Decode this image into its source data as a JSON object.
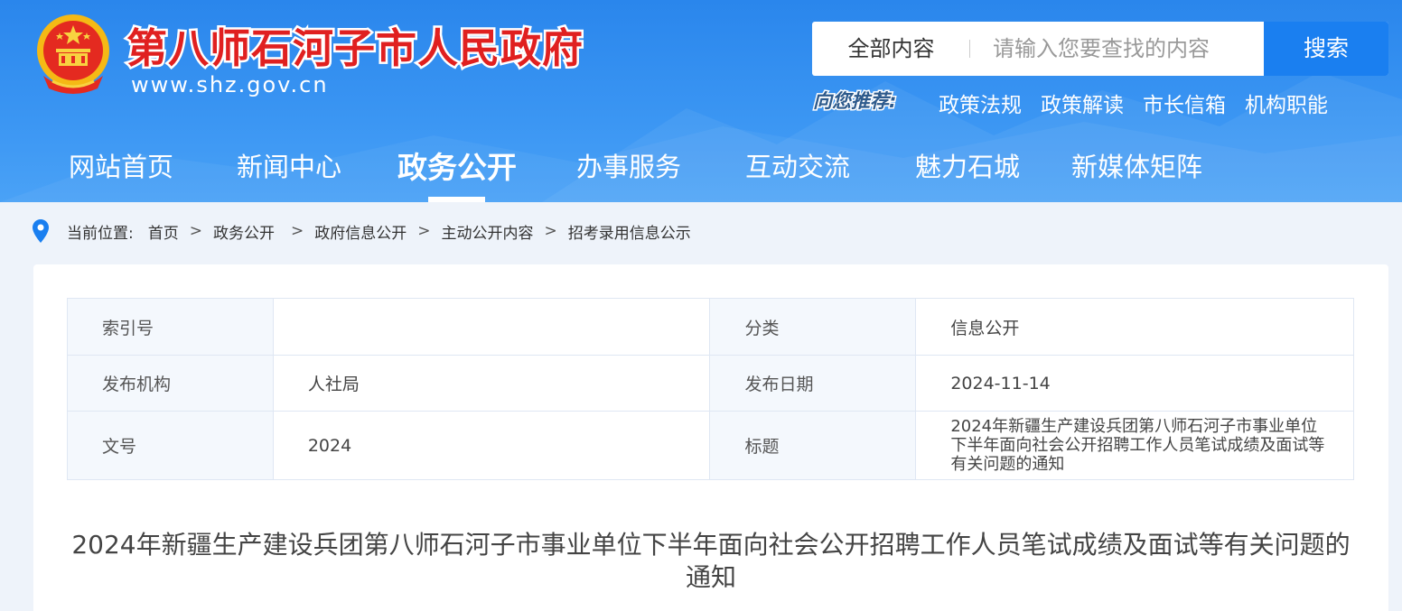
{
  "header": {
    "site_title": "第八师石河子市人民政府",
    "site_url": "www.shz.gov.cn",
    "accent_color": "#2a86ec"
  },
  "search": {
    "scope": "全部内容",
    "placeholder": "请输入您要查找的内容",
    "button": "搜索"
  },
  "recommend": {
    "label": "向您推荐:",
    "links": [
      "政策法规",
      "政策解读",
      "市长信箱",
      "机构职能"
    ]
  },
  "nav": {
    "items": [
      "网站首页",
      "新闻中心",
      "政务公开",
      "办事服务",
      "互动交流",
      "魅力石城",
      "新媒体矩阵"
    ],
    "active": "政务公开"
  },
  "breadcrumb": {
    "label": "当前位置:",
    "items": [
      "首页",
      "政务公开",
      "政府信息公开",
      "主动公开内容",
      "招考录用信息公示"
    ],
    "separator": ">"
  },
  "meta": {
    "index_label": "索引号",
    "index_value": "",
    "category_label": "分类",
    "category_value": "信息公开",
    "publisher_label": "发布机构",
    "publisher_value": "人社局",
    "date_label": "发布日期",
    "date_value": "2024-11-14",
    "docno_label": "文号",
    "docno_value": "2024",
    "title_label": "标题",
    "title_value": "2024年新疆生产建设兵团第八师石河子市事业单位下半年面向社会公开招聘工作人员笔试成绩及面试等有关问题的通知"
  },
  "article": {
    "title": "2024年新疆生产建设兵团第八师石河子市事业单位下半年面向社会公开招聘工作人员笔试成绩及面试等有关问题的通知"
  }
}
